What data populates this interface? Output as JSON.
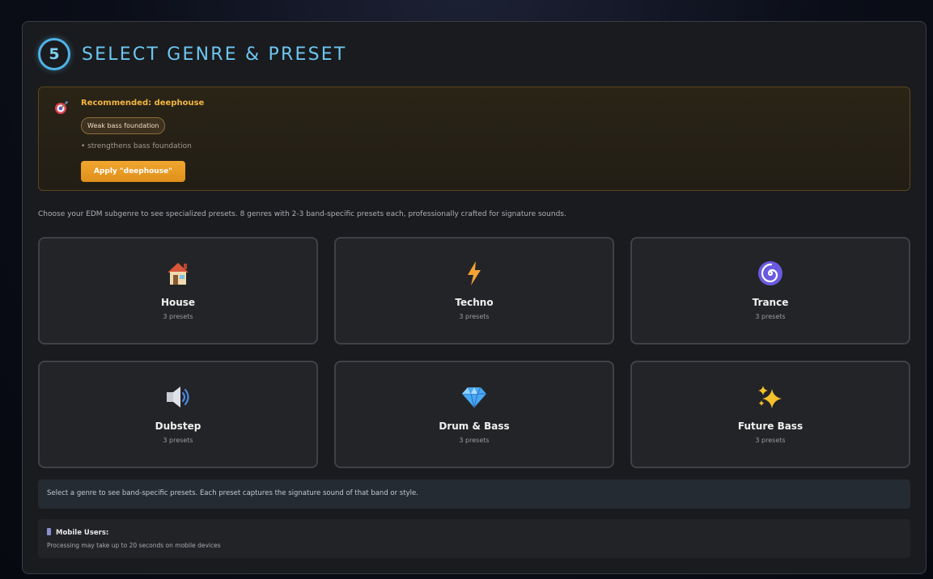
{
  "step": {
    "number": "5",
    "title": "SELECT GENRE & PRESET"
  },
  "recommendation": {
    "label": "Recommended: ",
    "genre": "deephouse",
    "tag": "Weak bass foundation",
    "detail": "• strengthens bass foundation",
    "apply_label": "Apply \"deephouse\""
  },
  "intro_text": "Choose your EDM subgenre to see specialized presets. 8 genres with 2-3 band-specific presets each, professionally crafted for signature sounds.",
  "genres": [
    {
      "name": "House",
      "count": "3 presets",
      "icon": "house-icon"
    },
    {
      "name": "Techno",
      "count": "3 presets",
      "icon": "lightning-icon"
    },
    {
      "name": "Trance",
      "count": "3 presets",
      "icon": "spiral-icon"
    },
    {
      "name": "Dubstep",
      "count": "3 presets",
      "icon": "speaker-icon"
    },
    {
      "name": "Drum & Bass",
      "count": "3 presets",
      "icon": "gem-icon"
    },
    {
      "name": "Future Bass",
      "count": "3 presets",
      "icon": "sparkles-icon"
    }
  ],
  "info_text": "Select a genre to see band-specific presets. Each preset captures the signature sound of that band or style.",
  "mobile": {
    "title": "Mobile Users:",
    "text": "Processing may take up to 20 seconds on mobile devices"
  },
  "colors": {
    "accent": "#4fb4e6",
    "recommend": "#f2b640",
    "apply_button": "#e8981f",
    "card_bg": "#232427"
  }
}
